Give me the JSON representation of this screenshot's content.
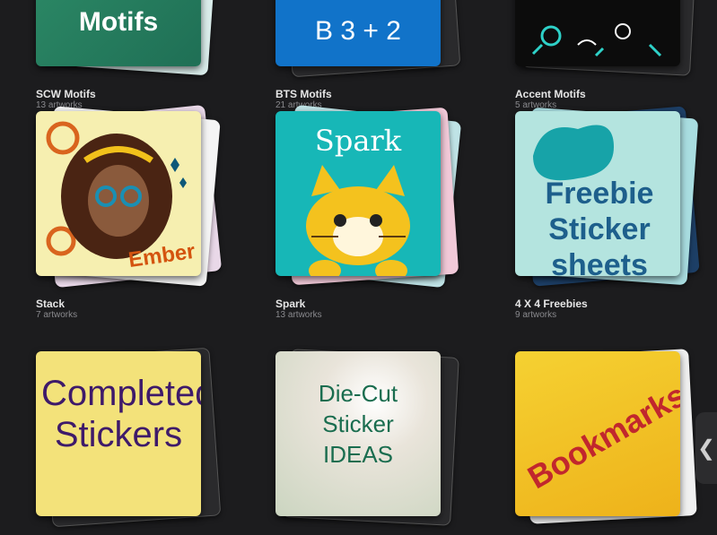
{
  "stacks": [
    {
      "title": "SCW Motifs",
      "count": "13 artworks",
      "art_text": "Motifs"
    },
    {
      "title": "BTS Motifs",
      "count": "21 artworks",
      "art_text": "B 3 + 2"
    },
    {
      "title": "Accent Motifs",
      "count": "5 artworks",
      "art_text": ""
    },
    {
      "title": "Stack",
      "count": "7 artworks",
      "art_text": "Ember"
    },
    {
      "title": "Spark",
      "count": "13 artworks",
      "art_text": "Spark"
    },
    {
      "title": "4 X 4 Freebies",
      "count": "9 artworks",
      "art_text": "Freebie Sticker sheets"
    },
    {
      "title": "",
      "count": "",
      "art_text": "Completed Stickers"
    },
    {
      "title": "",
      "count": "",
      "art_text": "Die-Cut Sticker IDEAS"
    },
    {
      "title": "",
      "count": "",
      "art_text": "Bookmarks"
    }
  ],
  "sidebar_toggle": {
    "icon": "chevron-left-icon",
    "glyph": "❮"
  },
  "colors": {
    "background": "#1c1c1e",
    "title": "#e6e6e6",
    "count": "#8a8a8e"
  }
}
